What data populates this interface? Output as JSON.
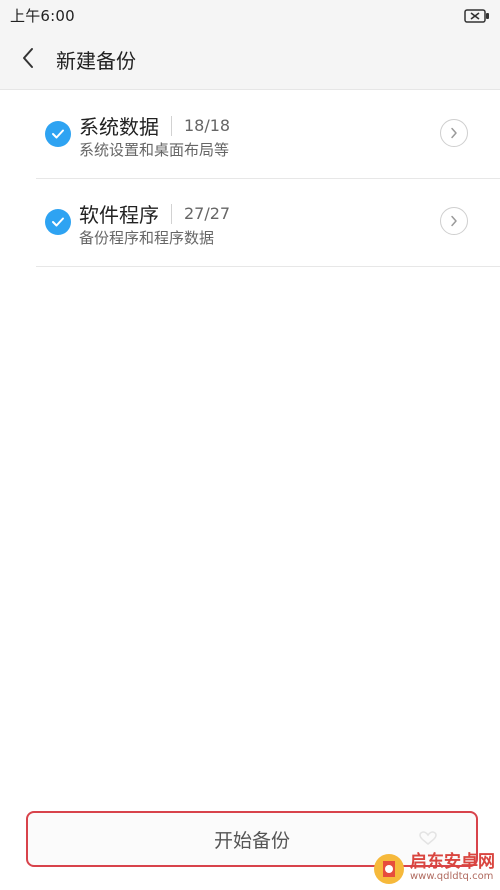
{
  "status_bar": {
    "time": "上午6:00",
    "battery_icon": "battery-x-icon"
  },
  "header": {
    "back_icon": "chevron-left-icon",
    "title": "新建备份"
  },
  "items": [
    {
      "title": "系统数据",
      "count": "18/18",
      "subtitle": "系统设置和桌面布局等",
      "checked": true
    },
    {
      "title": "软件程序",
      "count": "27/27",
      "subtitle": "备份程序和程序数据",
      "checked": true
    }
  ],
  "footer": {
    "start_label": "开始备份"
  },
  "watermark": {
    "title": "启东安卓网",
    "url": "www.qdldtq.com"
  },
  "colors": {
    "accent": "#2ea3f2",
    "highlight_border": "#d8434b"
  }
}
